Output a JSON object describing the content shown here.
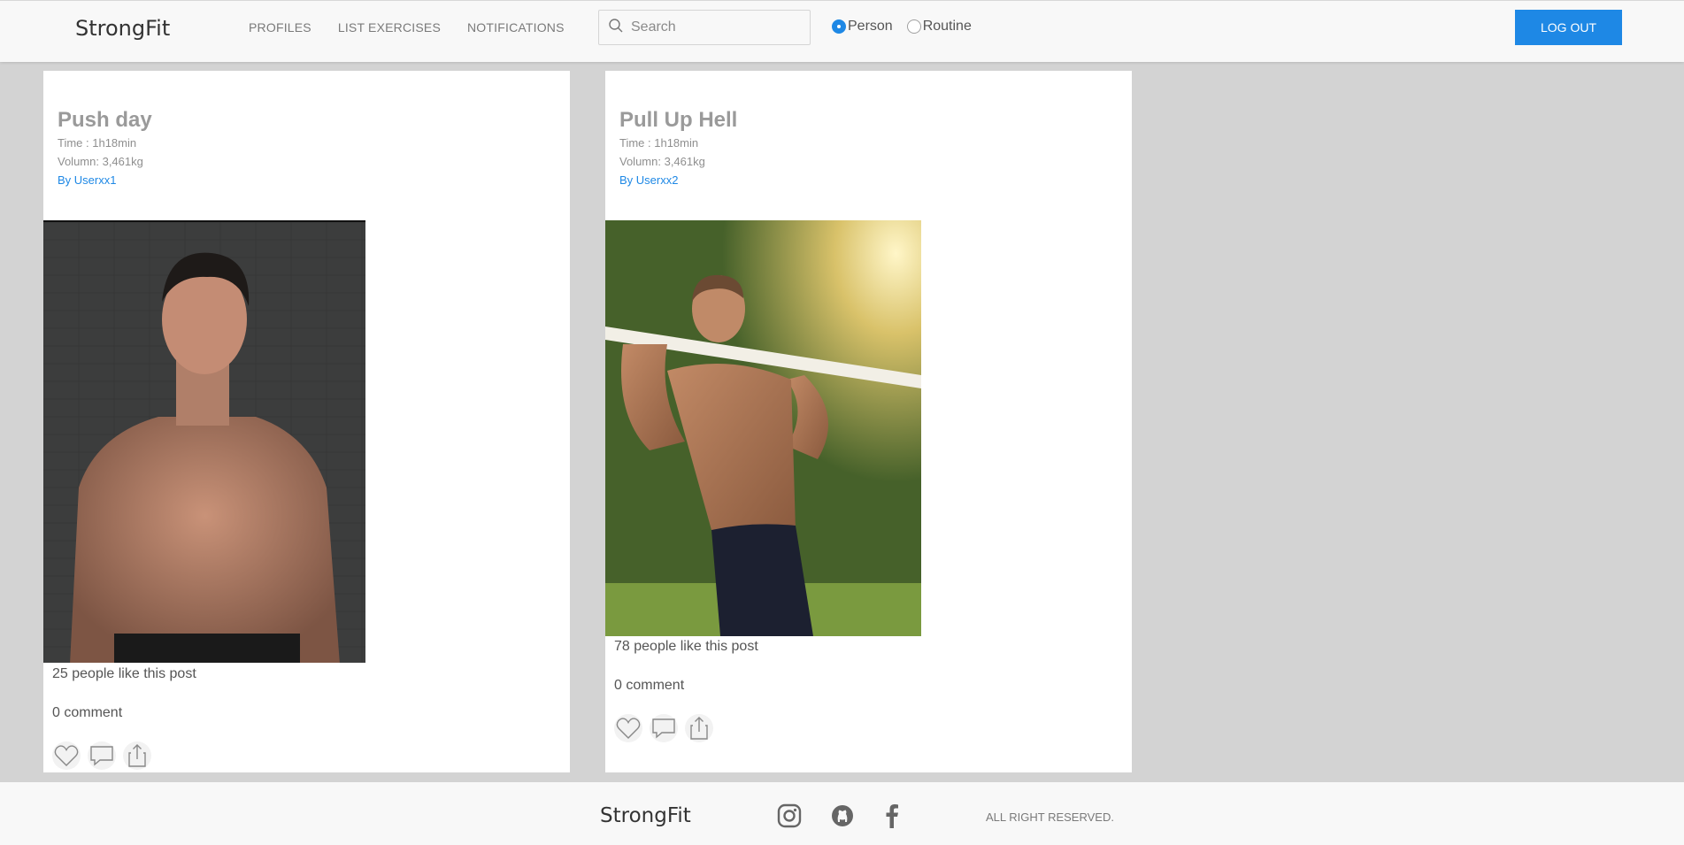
{
  "header": {
    "brand": "StrongFit",
    "nav": [
      {
        "label": "PROFILES"
      },
      {
        "label": "LIST EXERCISES"
      },
      {
        "label": "NOTIFICATIONS"
      }
    ],
    "search": {
      "placeholder": "Search",
      "value": "",
      "icon": "search-icon"
    },
    "search_type": {
      "options": [
        "Person",
        "Routine"
      ],
      "selected": "Person"
    },
    "logout_label": "LOG OUT"
  },
  "posts": [
    {
      "title": "Push day",
      "time": "Time : 1h18min",
      "volume": "Volumn: 3,461kg",
      "author": "By Userxx1",
      "likes_text": "25 people like this post",
      "comments_text": "0 comment"
    },
    {
      "title": "Pull Up Hell",
      "time": "Time : 1h18min",
      "volume": "Volumn: 3,461kg",
      "author": "By Userxx2",
      "likes_text": "78 people like this post",
      "comments_text": "0 comment"
    }
  ],
  "footer": {
    "brand": "StrongFit",
    "social_icons": [
      "instagram-icon",
      "github-icon",
      "facebook-icon"
    ],
    "rights": "ALL RIGHT RESERVED."
  },
  "colors": {
    "accent": "#1e88e5",
    "background": "#d3d3d3",
    "header_bg": "#f8f8f8"
  }
}
